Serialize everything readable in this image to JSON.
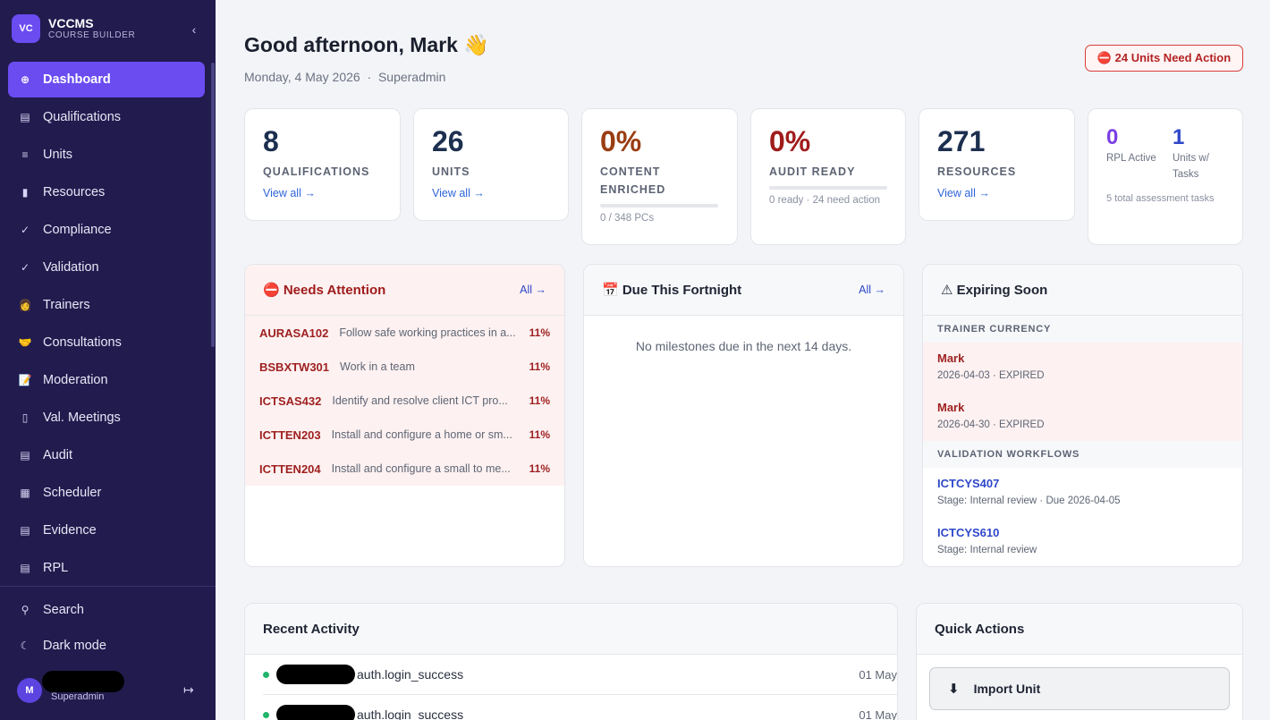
{
  "sidebar": {
    "logo": "VC",
    "app_name": "VCCMS",
    "app_sub": "COURSE BUILDER",
    "collapse_icon": "‹",
    "items": [
      {
        "label": "Dashboard",
        "icon": "⊕"
      },
      {
        "label": "Qualifications",
        "icon": "▤"
      },
      {
        "label": "Units",
        "icon": "≡"
      },
      {
        "label": "Resources",
        "icon": "▮"
      },
      {
        "label": "Compliance",
        "icon": "✓"
      },
      {
        "label": "Validation",
        "icon": "✓"
      },
      {
        "label": "Trainers",
        "icon": "👩"
      },
      {
        "label": "Consultations",
        "icon": "🤝"
      },
      {
        "label": "Moderation",
        "icon": "📝"
      },
      {
        "label": "Val. Meetings",
        "icon": "▯"
      },
      {
        "label": "Audit",
        "icon": "▤"
      },
      {
        "label": "Scheduler",
        "icon": "▦"
      },
      {
        "label": "Evidence",
        "icon": "▤"
      },
      {
        "label": "RPL",
        "icon": "▤"
      }
    ],
    "search_label": "Search",
    "search_icon": "⚲",
    "dark_mode_label": "Dark mode",
    "dark_mode_icon": "☾",
    "user_initial": "M",
    "user_role": "Superadmin",
    "logout_icon": "↦"
  },
  "header": {
    "greeting": "Good afternoon, Mark 👋",
    "date": "Monday, 4 May 2026",
    "separator": "·",
    "role": "Superadmin",
    "alert": "⛔ 24 Units Need Action"
  },
  "stats": {
    "qualifications": {
      "value": "8",
      "label": "QUALIFICATIONS",
      "link": "View all →"
    },
    "units": {
      "value": "26",
      "label": "UNITS",
      "link": "View all →"
    },
    "content": {
      "value": "0%",
      "label": "CONTENT ENRICHED",
      "sub": "0 / 348 PCs",
      "progress": 0
    },
    "audit": {
      "value": "0%",
      "label": "AUDIT READY",
      "sub": "0 ready · 24 need action",
      "progress": 0
    },
    "resources": {
      "value": "271",
      "label": "RESOURCES",
      "link": "View all →"
    },
    "rpl": {
      "rpl_value": "0",
      "rpl_label": "RPL Active",
      "tasks_value": "1",
      "tasks_label": "Units w/ Tasks",
      "sub": "5 total assessment tasks"
    }
  },
  "needs_attention": {
    "title": "⛔ Needs Attention",
    "link": "All →",
    "rows": [
      {
        "code": "AURASA102",
        "title": "Follow safe working practices in a...",
        "pct": "11%"
      },
      {
        "code": "BSBXTW301",
        "title": "Work in a team",
        "pct": "11%"
      },
      {
        "code": "ICTSAS432",
        "title": "Identify and resolve client ICT pro...",
        "pct": "11%"
      },
      {
        "code": "ICTTEN203",
        "title": "Install and configure a home or sm...",
        "pct": "11%"
      },
      {
        "code": "ICTTEN204",
        "title": "Install and configure a small to me...",
        "pct": "11%"
      }
    ]
  },
  "due": {
    "title": "📅 Due This Fortnight",
    "link": "All →",
    "empty": "No milestones due in the next 14 days."
  },
  "expiring": {
    "title": "⚠ Expiring Soon",
    "trainer_heading": "TRAINER CURRENCY",
    "trainers": [
      {
        "name": "Mark",
        "meta": "2026-04-03 · EXPIRED"
      },
      {
        "name": "Mark",
        "meta": "2026-04-30 · EXPIRED"
      }
    ],
    "workflow_heading": "VALIDATION WORKFLOWS",
    "workflows": [
      {
        "code": "ICTCYS407",
        "meta": "Stage: Internal review · Due 2026-04-05"
      },
      {
        "code": "ICTCYS610",
        "meta": "Stage: Internal review"
      }
    ]
  },
  "activity": {
    "title": "Recent Activity",
    "rows": [
      {
        "action": "auth.login_success",
        "date": "01 May"
      },
      {
        "action": "auth.login_success",
        "date": "01 May"
      }
    ]
  },
  "quick_actions": {
    "title": "Quick Actions",
    "import_label": "Import Unit",
    "import_icon": "⬇"
  },
  "colors": {
    "accent": "#6a4cf0",
    "sidebar": "#211b4e",
    "danger": "#b42323",
    "link": "#2e64d8"
  }
}
